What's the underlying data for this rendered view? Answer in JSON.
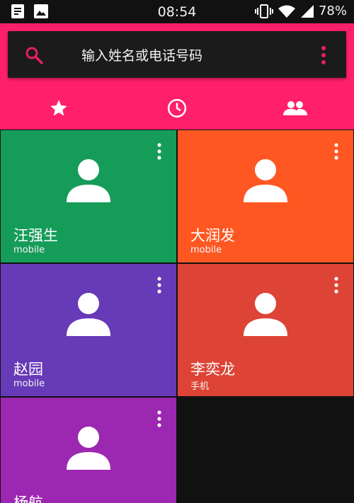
{
  "status_bar": {
    "time": "08:54",
    "battery": "78%",
    "icons": [
      "document-icon",
      "image-icon",
      "vibrate-icon",
      "wifi-icon",
      "signal-icon",
      "battery-icon"
    ]
  },
  "search": {
    "placeholder": "输入姓名或电话号码"
  },
  "tabs": [
    {
      "name": "favorites",
      "icon": "star-icon"
    },
    {
      "name": "recent",
      "icon": "clock-icon"
    },
    {
      "name": "contacts",
      "icon": "people-icon"
    }
  ],
  "colors": {
    "header": "#ff1f6b",
    "search_bar": "#1b1b1b",
    "accent": "#e91e63"
  },
  "contacts": [
    {
      "name": "汪强生",
      "label": "mobile",
      "color": "#169c59"
    },
    {
      "name": "大润发",
      "label": "mobile",
      "color": "#ff5722"
    },
    {
      "name": "赵园",
      "label": "mobile",
      "color": "#673ab7"
    },
    {
      "name": "李奕龙",
      "label": "手机",
      "color": "#dd4436"
    },
    {
      "name": "杨航",
      "label": "",
      "color": "#9c27b0"
    }
  ]
}
